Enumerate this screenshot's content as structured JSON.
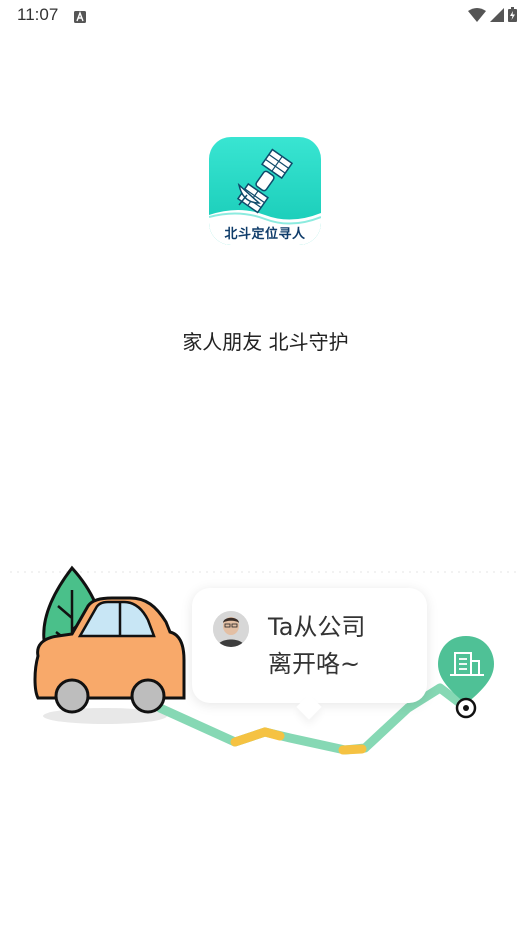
{
  "status_bar": {
    "time": "11:07",
    "notification_icon": "text-a-icon",
    "icons": [
      "wifi-icon",
      "signal-icon",
      "battery-icon"
    ]
  },
  "app": {
    "logo_label": "北斗定位寻人",
    "logo_icon": "satellite-icon",
    "slogan": "家人朋友 北斗守护"
  },
  "illustration": {
    "bubble_line1": "Ta从公司",
    "bubble_line2": "离开咯~",
    "icons": [
      "tree-icon",
      "car-icon",
      "avatar",
      "building-pin-icon",
      "destination-dot-icon"
    ],
    "colors": {
      "route": "#86d8b4",
      "route_highlight": "#f5c242",
      "pin": "#4fc196",
      "car": "#f7a86a",
      "tree": "#4ac08a"
    }
  }
}
